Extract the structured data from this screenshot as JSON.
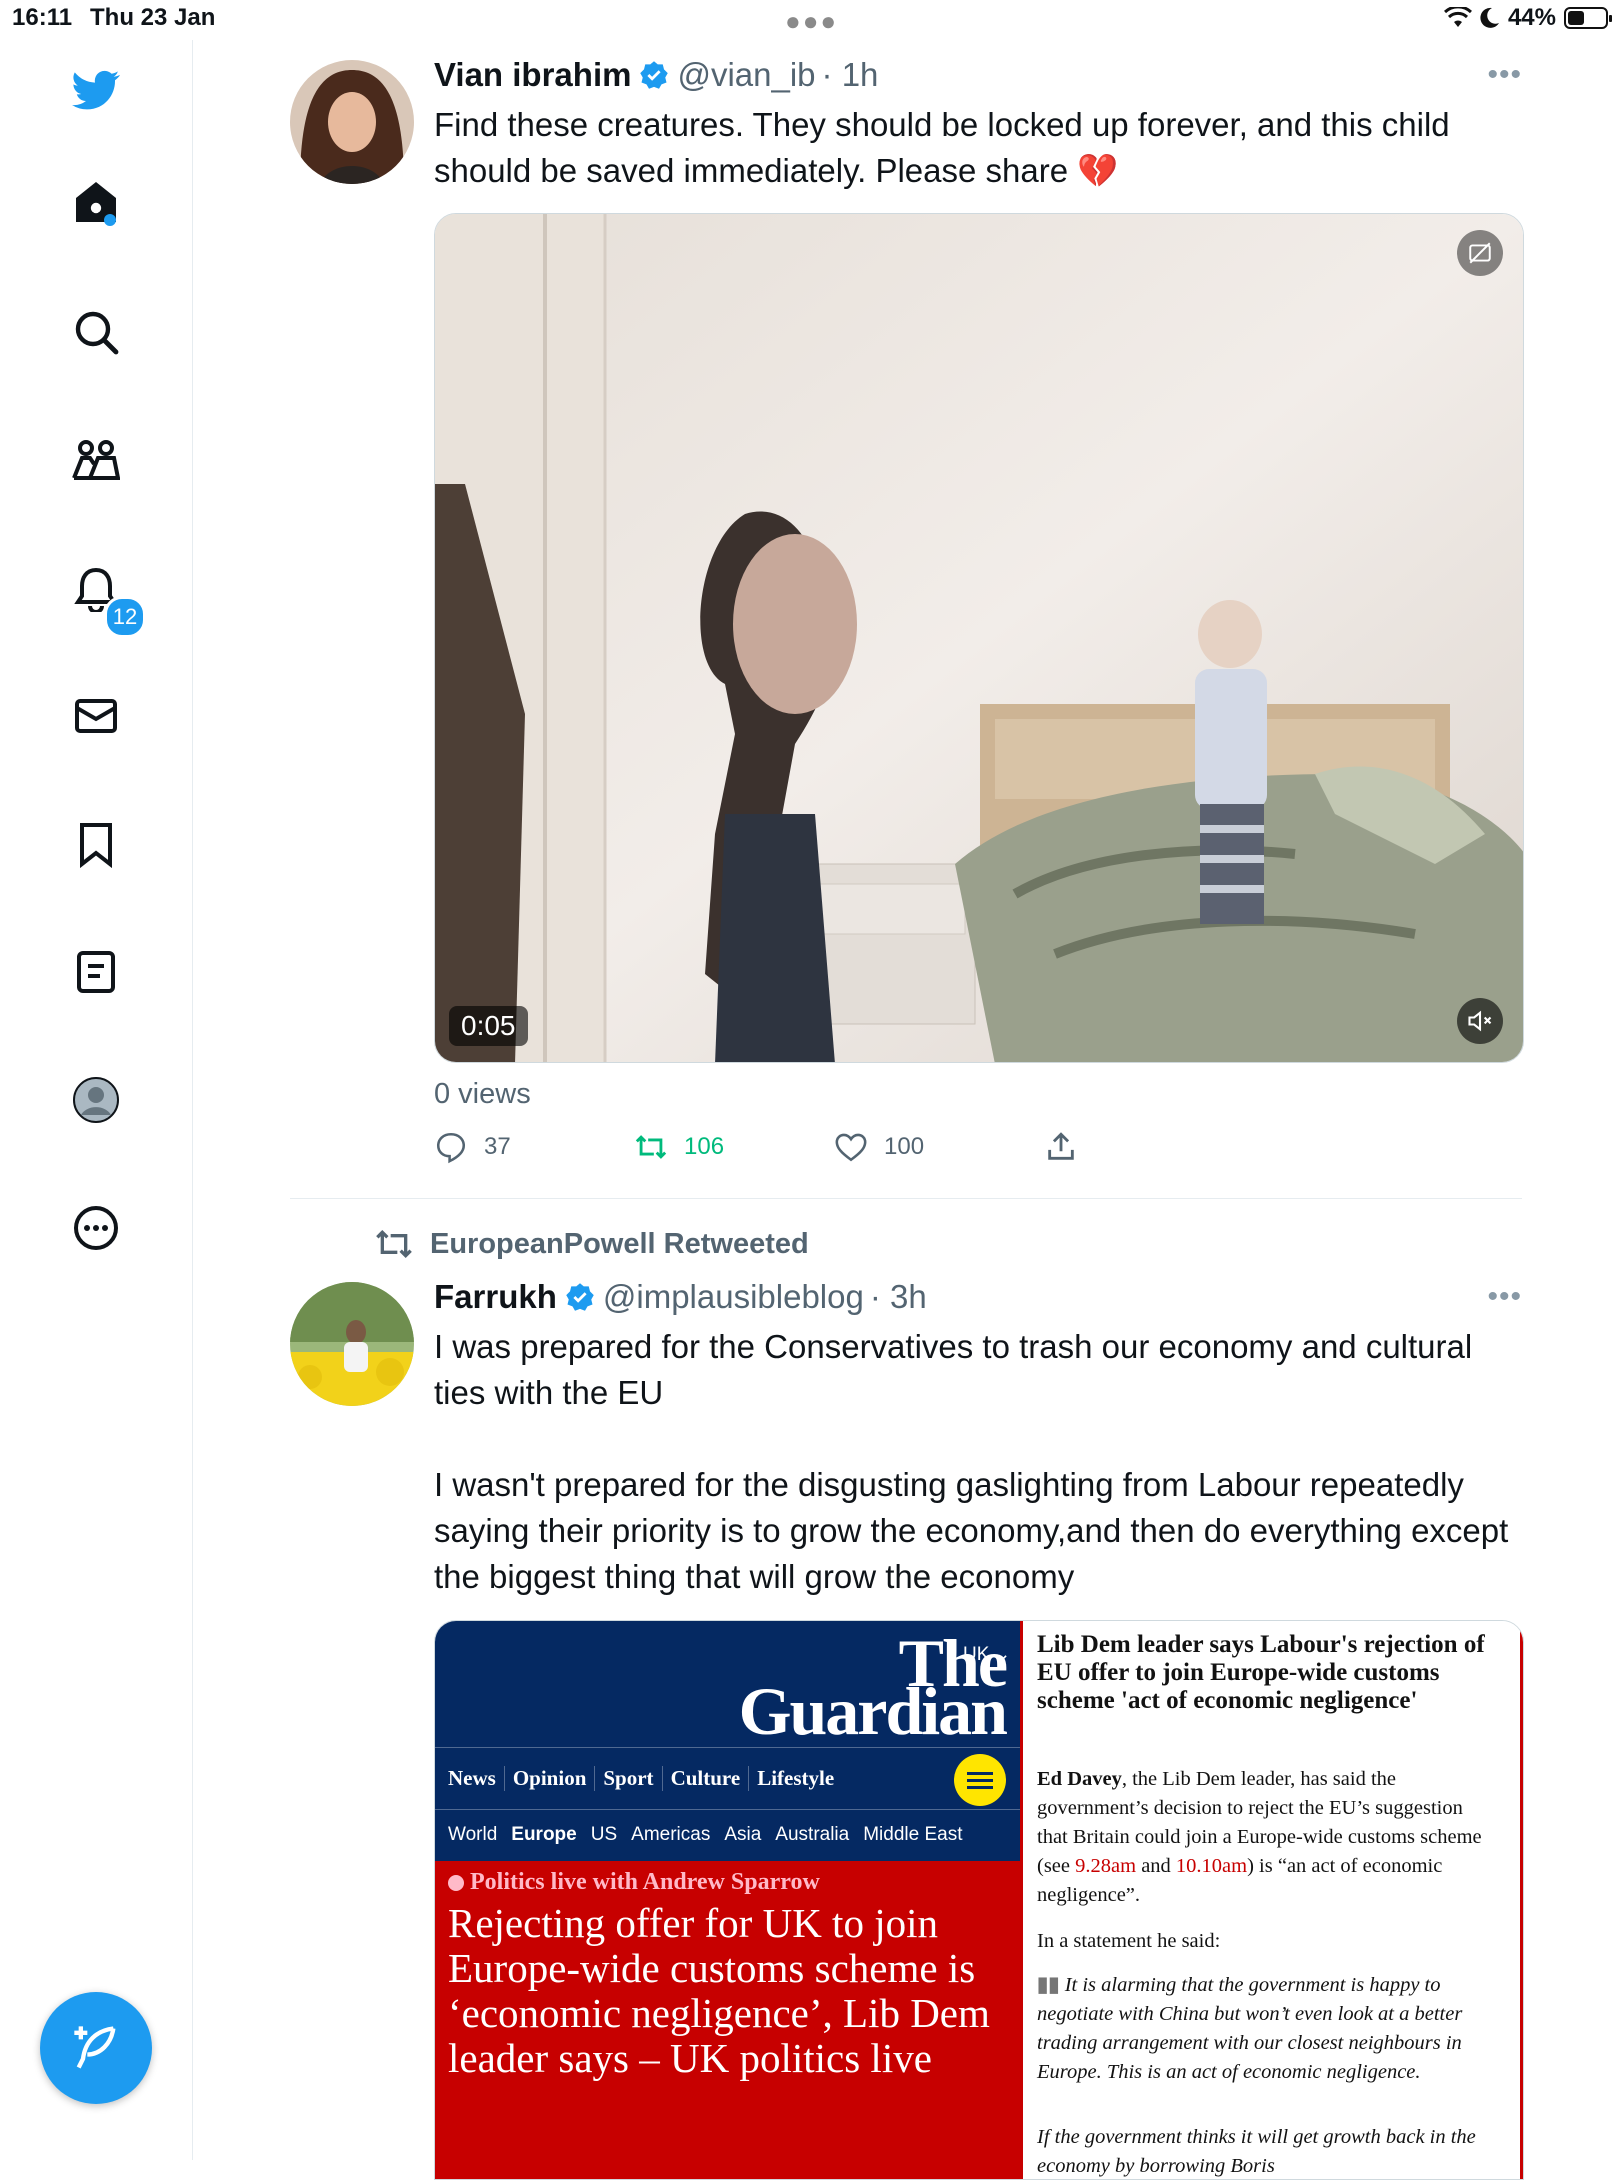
{
  "status_bar": {
    "time": "16:11",
    "date": "Thu 23 Jan",
    "battery": "44%",
    "battery_level": 0.44
  },
  "sidebar": {
    "notifications_badge": "12",
    "items": [
      "twitter-logo",
      "home",
      "search",
      "communities",
      "notifications",
      "messages",
      "bookmarks",
      "lists",
      "profile",
      "more"
    ]
  },
  "tweets": [
    {
      "name": "Vian ibrahim",
      "handle": "@vian_ib",
      "time": "· 1h",
      "text": "Find these creatures. They should be locked up forever, and this child should be saved immediately. Please share 💔",
      "video_duration": "0:05",
      "views": "0 views",
      "replies": "37",
      "retweets": "106",
      "likes": "100"
    },
    {
      "retweeted_by": "EuropeanPowell Retweeted",
      "name": "Farrukh",
      "handle": "@implausibleblog",
      "time": "· 3h",
      "text_p1": "I was prepared for the Conservatives to trash our economy and cultural ties with the EU",
      "text_p2": "I wasn't prepared for the disgusting gaslighting from Labour repeatedly saying their priority is to grow the economy,and then do everything except the biggest thing that will grow the economy"
    }
  ],
  "guardian": {
    "edition": "UK",
    "masthead_1": "The",
    "masthead_2": "Guardian",
    "nav": [
      "News",
      "Opinion",
      "Sport",
      "Culture",
      "Lifestyle"
    ],
    "subnav": [
      "World",
      "Europe",
      "US",
      "Americas",
      "Asia",
      "Australia",
      "Middle East"
    ],
    "kicker": "Politics live with Andrew Sparrow",
    "headline": "Rejecting offer for UK to join Europe-wide customs scheme is ‘economic negligence’, Lib Dem leader says – UK politics live",
    "right_headline": "Lib Dem leader says Labour's rejection of EU offer to join Europe-wide customs scheme 'act of economic negligence'",
    "right_para_lead": "Ed Davey",
    "right_para_1a": ", the Lib Dem leader, has said the government’s decision to reject the EU’s suggestion that Britain could join a Europe-wide customs scheme (see ",
    "link_1": "9.28am",
    "right_para_1b": " and ",
    "link_2": "10.10am",
    "right_para_1c": ") is “an act of economic negligence”.",
    "right_para_2": "In a statement he said:",
    "quote": "It is alarming that the government is happy to negotiate with China but won’t even look at a better trading arrangement with our closest neighbours in Europe. This is an act of economic negligence.",
    "quote_2": "If the government thinks it will get growth back in the economy by borrowing Boris"
  }
}
